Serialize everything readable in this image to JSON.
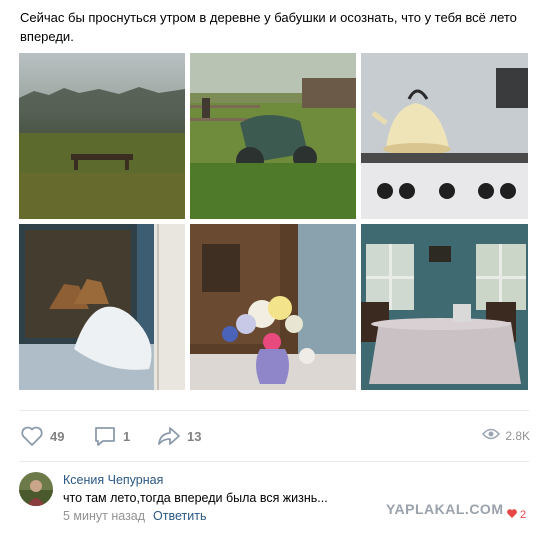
{
  "post": {
    "text": "Сейчас бы проснуться утром в деревне у бабушки и осознать, что у тебя всё лето впереди."
  },
  "photos": [
    {
      "name": "photo-field-bench",
      "subject": "foggy field with bench"
    },
    {
      "name": "photo-motorcycle-grass",
      "subject": "old motorcycle in grass"
    },
    {
      "name": "photo-kettle-stove",
      "subject": "enamel kettle on gas stove"
    },
    {
      "name": "photo-bed-carpet",
      "subject": "bed with deer carpet"
    },
    {
      "name": "photo-flowers-vase",
      "subject": "wildflowers in vase"
    },
    {
      "name": "photo-table-windows",
      "subject": "table by windows"
    }
  ],
  "actions": {
    "likes": "49",
    "comments": "1",
    "shares": "13",
    "views": "2.8K"
  },
  "comment": {
    "author": "Ксения Чепурная",
    "text": "что там лето,тогда впереди была вся жизнь...",
    "time": "5 минут назад",
    "reply_label": "Ответить",
    "likes": "2"
  },
  "watermark": "YAPLAKAL.COM",
  "colors": {
    "link": "#2a5885",
    "muted": "#828282",
    "divider": "#e7e8ec",
    "like_red": "#e64646"
  }
}
